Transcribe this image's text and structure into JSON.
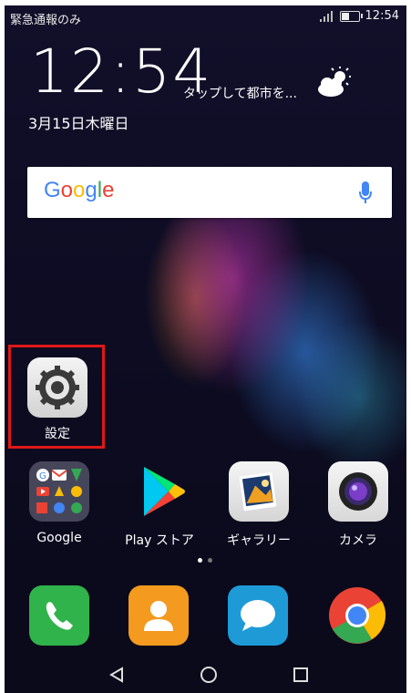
{
  "status_bar": {
    "left_text": "緊急通報のみ",
    "time": "12:54"
  },
  "clock_widget": {
    "time": "12:54",
    "weather_prompt": "タップして都市を...",
    "date": "3月15日木曜日",
    "weather_icon": "partly-cloudy-icon"
  },
  "search_bar": {
    "logo_letters": [
      {
        "char": "G",
        "color": "#4285F4"
      },
      {
        "char": "o",
        "color": "#EA4335"
      },
      {
        "char": "o",
        "color": "#FBBC05"
      },
      {
        "char": "g",
        "color": "#4285F4"
      },
      {
        "char": "l",
        "color": "#34A853"
      },
      {
        "char": "e",
        "color": "#EA4335"
      }
    ],
    "mic_icon": "mic-icon"
  },
  "highlighted_app": {
    "label": "設定",
    "icon": "settings-gear-icon",
    "highlight_color": "#e01818"
  },
  "apps": [
    {
      "label": "Google",
      "icon": "google-folder-icon"
    },
    {
      "label": "Play ストア",
      "icon": "play-store-icon"
    },
    {
      "label": "ギャラリー",
      "icon": "gallery-icon"
    },
    {
      "label": "カメラ",
      "icon": "camera-icon"
    }
  ],
  "page_indicator": {
    "pages": 2,
    "active": 0
  },
  "dock": [
    {
      "icon": "phone-icon",
      "color": "#2fb34a"
    },
    {
      "icon": "contacts-icon",
      "color": "#f39a1f"
    },
    {
      "icon": "messages-icon",
      "color": "#1e9bd7"
    },
    {
      "icon": "chrome-icon",
      "color": "#ffffff"
    }
  ],
  "nav_bar": [
    "back-icon",
    "home-icon",
    "recents-icon"
  ]
}
